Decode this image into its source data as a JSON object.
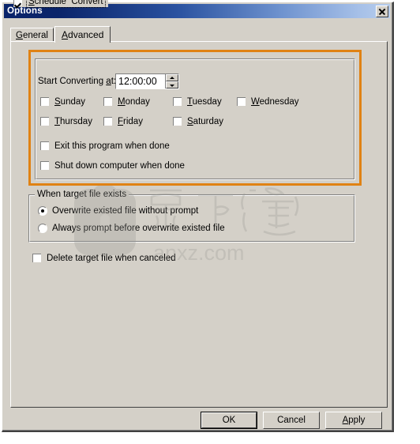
{
  "window": {
    "title": "Options",
    "close_icon": "close-icon"
  },
  "tabs": [
    {
      "label": "General",
      "accel": "G",
      "active": false
    },
    {
      "label": "Advanced",
      "accel": "A",
      "active": true
    }
  ],
  "schedule_group": {
    "caption": "Schedule  Convert",
    "caption_accel": "S",
    "checked": true,
    "focused": true,
    "time_label_pre": "Start Converting ",
    "time_label_accel": "a",
    "time_label_post": "t:",
    "time_value": "12:00:00",
    "spinner_up_icon": "chevron-up-icon",
    "spinner_down_icon": "chevron-down-icon",
    "days": [
      {
        "label": "Sunday",
        "accel": "S",
        "checked": false
      },
      {
        "label": "Monday",
        "accel": "M",
        "checked": false
      },
      {
        "label": "Tuesday",
        "accel": "T",
        "checked": false
      },
      {
        "label": "Wednesday",
        "accel": "W",
        "checked": false
      },
      {
        "label": "Thursday",
        "accel": "T",
        "checked": false
      },
      {
        "label": "Friday",
        "accel": "F",
        "checked": false
      },
      {
        "label": "Saturday",
        "accel": "S",
        "checked": false
      }
    ],
    "post_actions": [
      {
        "label": "Exit this program when done",
        "checked": false
      },
      {
        "label": "Shut down computer when done",
        "checked": false
      }
    ]
  },
  "target_group": {
    "caption": "When target file exists",
    "options": [
      {
        "label": "Overwrite existed file without prompt",
        "selected": true
      },
      {
        "label": "Always prompt before overwrite existed file",
        "selected": false
      }
    ]
  },
  "delete_option": {
    "label": "Delete target file when canceled",
    "checked": false
  },
  "watermark": {
    "text_cn": "安下载",
    "text_url": "anxz.com",
    "icon": "bag-lock-icon"
  },
  "buttons": [
    {
      "label": "OK",
      "accel": "",
      "default": true
    },
    {
      "label": "Cancel",
      "accel": "",
      "default": false
    },
    {
      "label": "Apply",
      "accel": "A",
      "default": false
    }
  ],
  "colors": {
    "dialog_face": "#d4d0c8",
    "titlebar_start": "#0a246a",
    "titlebar_end": "#b7cdec",
    "highlight_orange": "#e08214",
    "field_bg": "#ffffff",
    "text": "#000000"
  }
}
